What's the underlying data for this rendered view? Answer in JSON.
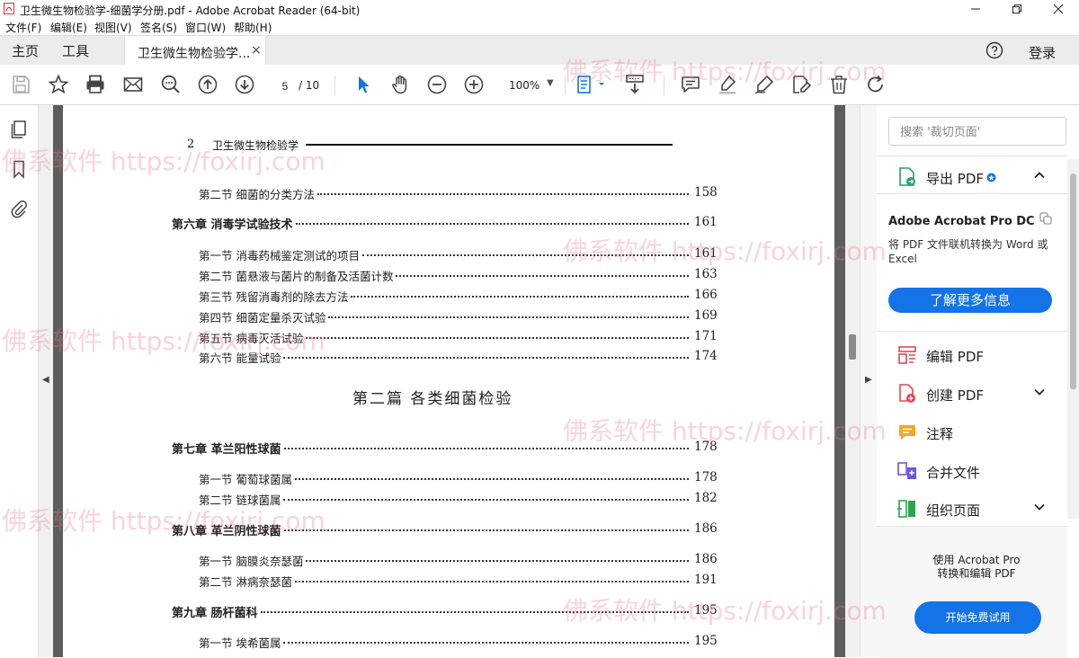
{
  "window": {
    "title": "卫生微生物检验学-细菌学分册.pdf - Adobe Acrobat Reader (64-bit)"
  },
  "menu": [
    "文件(F)",
    "编辑(E)",
    "视图(V)",
    "签名(S)",
    "窗口(W)",
    "帮助(H)"
  ],
  "tabs": {
    "home": "主页",
    "tools": "工具",
    "document": "卫生微生物检验学...",
    "close": "×",
    "login": "登录"
  },
  "toolbar": {
    "page_current": "5",
    "page_total": "/ 10",
    "zoom": "100%"
  },
  "document": {
    "header_number": "2",
    "header_title": "卫生微生物检验学",
    "part_title": "第二篇    各类细菌检验",
    "toc": [
      {
        "label": "第二节    细菌的分类方法",
        "page": "158",
        "level": 2
      },
      {
        "label": "第六章    消毒学试验技术",
        "page": "161",
        "level": 1
      },
      {
        "label": "第一节    消毒药械鉴定测试的项目",
        "page": "161",
        "level": 2
      },
      {
        "label": "第二节    菌悬液与菌片的制备及活菌计数",
        "page": "163",
        "level": 2
      },
      {
        "label": "第三节    残留消毒剂的除去方法",
        "page": "166",
        "level": 2
      },
      {
        "label": "第四节    细菌定量杀灭试验",
        "page": "169",
        "level": 2
      },
      {
        "label": "第五节    病毒灭活试验",
        "page": "171",
        "level": 2
      },
      {
        "label": "第六节    能量试验",
        "page": "174",
        "level": 2
      },
      {
        "label": "第七章    革兰阳性球菌",
        "page": "178",
        "level": 1
      },
      {
        "label": "第一节    葡萄球菌属",
        "page": "178",
        "level": 2
      },
      {
        "label": "第二节    链球菌属",
        "page": "182",
        "level": 2
      },
      {
        "label": "第八章    革兰阴性球菌",
        "page": "186",
        "level": 1
      },
      {
        "label": "第一节    脑膜炎奈瑟菌",
        "page": "186",
        "level": 2
      },
      {
        "label": "第二节    淋病奈瑟菌",
        "page": "191",
        "level": 2
      },
      {
        "label": "第九章    肠杆菌科",
        "page": "195",
        "level": 1
      },
      {
        "label": "第一节    埃希菌属",
        "page": "195",
        "level": 2
      }
    ]
  },
  "right_panel": {
    "search_placeholder": "搜索 '裁切页面'",
    "export_pdf": "导出 PDF",
    "promo_title": "Adobe Acrobat Pro DC",
    "promo_desc": "将 PDF 文件联机转换为 Word 或 Excel",
    "learn_more": "了解更多信息",
    "tools": [
      {
        "name": "编辑 PDF",
        "icon": "edit-pdf-icon",
        "color": "#e34850",
        "chevron": false
      },
      {
        "name": "创建 PDF",
        "icon": "create-pdf-icon",
        "color": "#e34850",
        "chevron": true
      },
      {
        "name": "注释",
        "icon": "comment-icon",
        "color": "#f5a623",
        "chevron": false
      },
      {
        "name": "合并文件",
        "icon": "combine-files-icon",
        "color": "#6e55e0",
        "chevron": false
      },
      {
        "name": "组织页面",
        "icon": "organize-pages-icon",
        "color": "#2da44e",
        "chevron": true
      }
    ],
    "bottom_text_1": "使用 Acrobat Pro",
    "bottom_text_2": "转换和编辑 PDF",
    "trial": "开始免费试用"
  },
  "watermark": "佛系软件 https://foxirj.com",
  "colors": {
    "accent": "#1473e6",
    "toolbar_icon": "#444444",
    "viewer_bg": "#5d5d5d"
  }
}
